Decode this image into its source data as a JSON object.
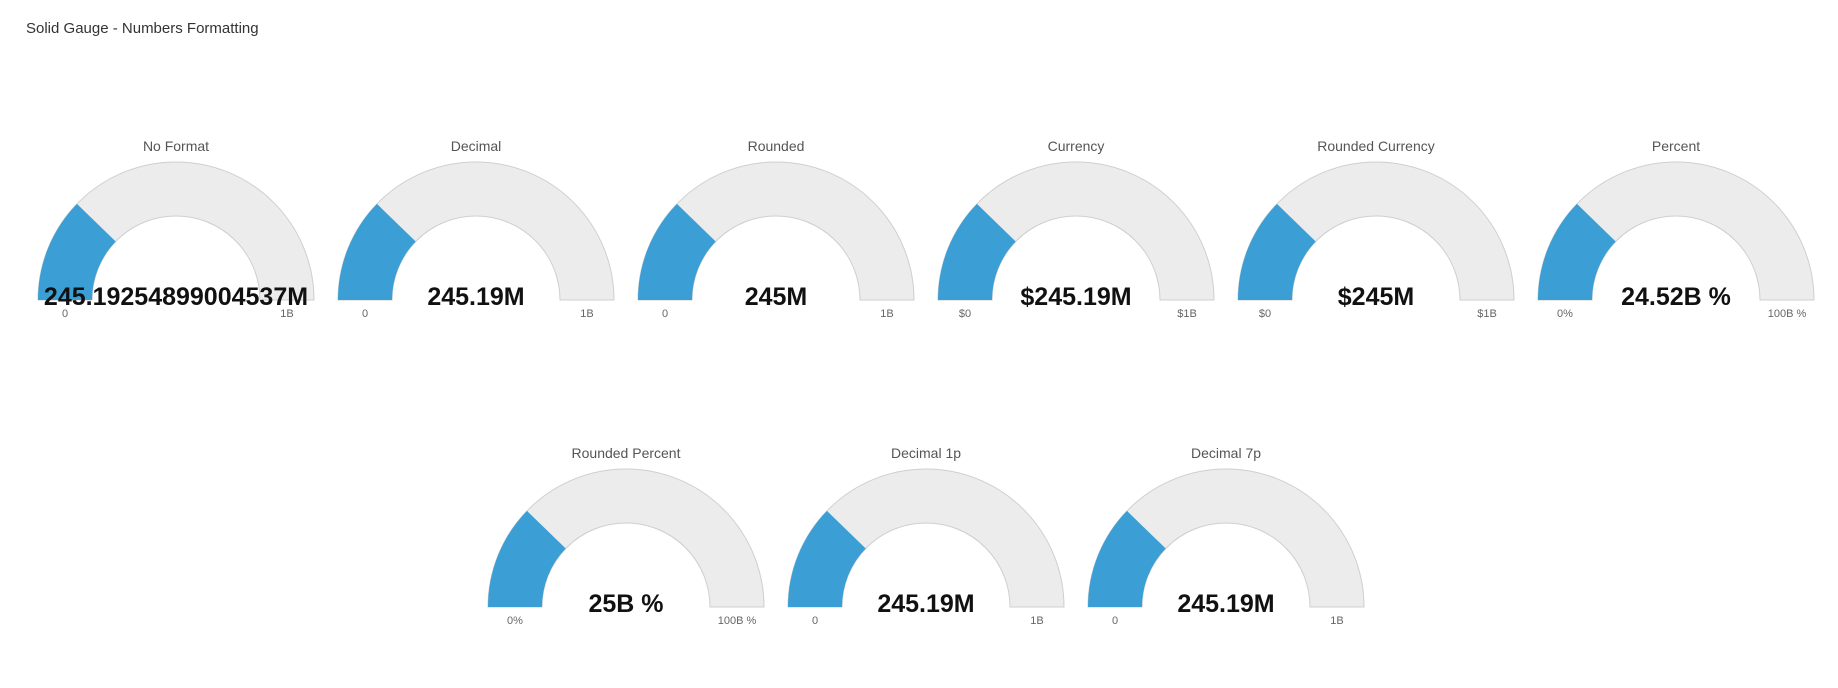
{
  "header": {
    "title": "Solid Gauge - Numbers Formatting"
  },
  "style": {
    "fill_color": "#3b9fd5",
    "track_color": "#ececec",
    "track_border": "#cfcfcf"
  },
  "chart_data": [
    {
      "type": "solid-gauge",
      "title": "No Format",
      "value": 245192548.99004537,
      "min": 0,
      "max": 1000000000,
      "value_label": "245.19254899004537M",
      "min_label": "0",
      "max_label": "1B"
    },
    {
      "type": "solid-gauge",
      "title": "Decimal",
      "value": 245192548.99004537,
      "min": 0,
      "max": 1000000000,
      "value_label": "245.19M",
      "min_label": "0",
      "max_label": "1B"
    },
    {
      "type": "solid-gauge",
      "title": "Rounded",
      "value": 245192548.99004537,
      "min": 0,
      "max": 1000000000,
      "value_label": "245M",
      "min_label": "0",
      "max_label": "1B"
    },
    {
      "type": "solid-gauge",
      "title": "Currency",
      "value": 245192548.99004537,
      "min": 0,
      "max": 1000000000,
      "value_label": "$245.19M",
      "min_label": "$0",
      "max_label": "$1B"
    },
    {
      "type": "solid-gauge",
      "title": "Rounded Currency",
      "value": 245192548.99004537,
      "min": 0,
      "max": 1000000000,
      "value_label": "$245M",
      "min_label": "$0",
      "max_label": "$1B"
    },
    {
      "type": "solid-gauge",
      "title": "Percent",
      "value": 245192548.99004537,
      "min": 0,
      "max": 1000000000,
      "value_label": "24.52B %",
      "min_label": "0%",
      "max_label": "100B %"
    },
    {
      "type": "solid-gauge",
      "title": "Rounded Percent",
      "value": 245192548.99004537,
      "min": 0,
      "max": 1000000000,
      "value_label": "25B %",
      "min_label": "0%",
      "max_label": "100B %"
    },
    {
      "type": "solid-gauge",
      "title": "Decimal 1p",
      "value": 245192548.99004537,
      "min": 0,
      "max": 1000000000,
      "value_label": "245.19M",
      "min_label": "0",
      "max_label": "1B"
    },
    {
      "type": "solid-gauge",
      "title": "Decimal 7p",
      "value": 245192548.99004537,
      "min": 0,
      "max": 1000000000,
      "value_label": "245.19M",
      "min_label": "0",
      "max_label": "1B"
    }
  ]
}
